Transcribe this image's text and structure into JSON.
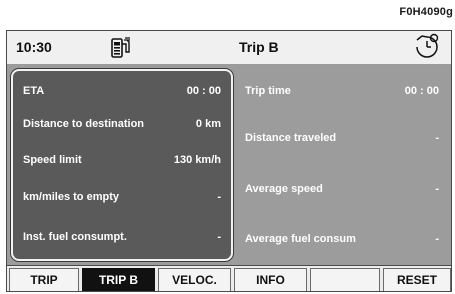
{
  "ref_code": "F0H4090g",
  "header": {
    "time": "10:30",
    "title": "Trip B",
    "fuel_icon": "fuel-pump-icon",
    "timer_icon": "stopwatch-icon"
  },
  "left_rows": [
    {
      "label": "ETA",
      "value": "00 : 00"
    },
    {
      "label": "Distance to destination",
      "value": "0 km"
    },
    {
      "label": "Speed limit",
      "value": "130 km/h"
    },
    {
      "label": "km/miles to empty",
      "value": "-"
    },
    {
      "label": "Inst. fuel consumpt.",
      "value": "-"
    }
  ],
  "right_rows": [
    {
      "label": "Trip time",
      "value": "00 : 00"
    },
    {
      "label": "Distance traveled",
      "value": "-"
    },
    {
      "label": "Average speed",
      "value": "-"
    },
    {
      "label": "Average fuel consum",
      "value": "-"
    }
  ],
  "tabs": [
    {
      "label": "TRIP"
    },
    {
      "label": "TRIP B"
    },
    {
      "label": "VELOC."
    },
    {
      "label": "INFO"
    },
    {
      "label": ""
    },
    {
      "label": "RESET"
    }
  ],
  "colors": {
    "panel_bg": "#9c9c9c",
    "selected_panel_bg": "#5a5a5a",
    "active_tab_bg": "#111111"
  }
}
